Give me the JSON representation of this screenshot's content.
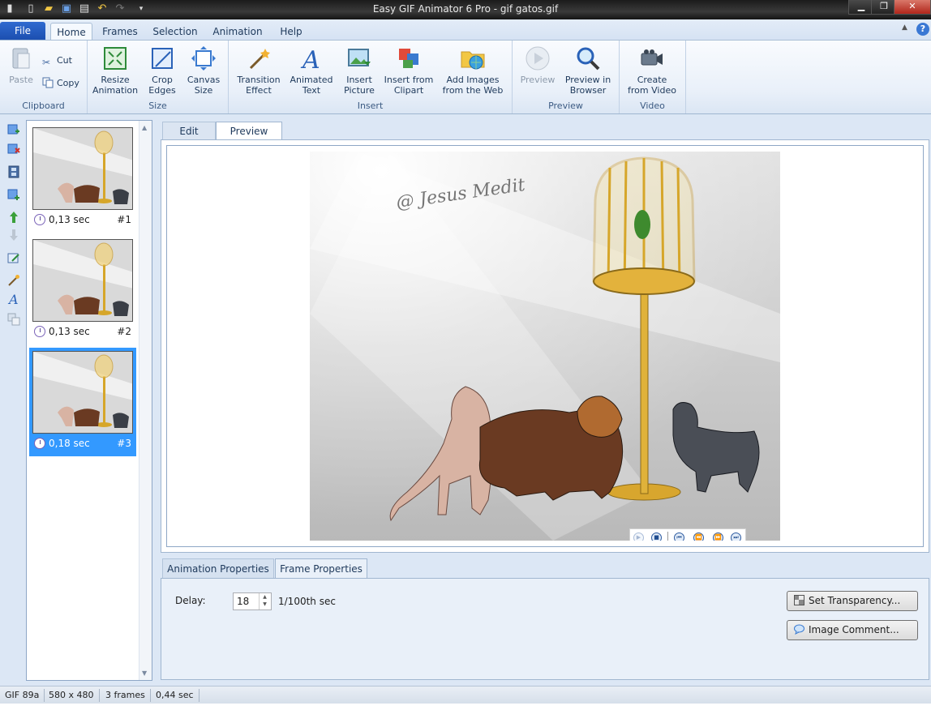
{
  "window": {
    "title": "Easy GIF Animator 6 Pro - gif gatos.gif"
  },
  "ribbon": {
    "file_tab": "File",
    "tabs": [
      {
        "label": "Home"
      },
      {
        "label": "Frames"
      },
      {
        "label": "Selection"
      },
      {
        "label": "Animation"
      },
      {
        "label": "Help"
      }
    ],
    "groups": {
      "clipboard": {
        "label": "Clipboard",
        "paste": "Paste",
        "cut": "Cut",
        "copy": "Copy"
      },
      "size": {
        "label": "Size",
        "resize": "Resize\nAnimation",
        "crop": "Crop\nEdges",
        "canvas": "Canvas\nSize"
      },
      "insert": {
        "label": "Insert",
        "transition": "Transition\nEffect",
        "text": "Animated\nText",
        "picture": "Insert\nPicture",
        "clipart": "Insert from\nClipart",
        "web": "Add Images\nfrom the Web"
      },
      "preview": {
        "label": "Preview",
        "preview": "Preview",
        "browser": "Preview in\nBrowser"
      },
      "video": {
        "label": "Video",
        "create": "Create\nfrom Video"
      }
    },
    "help_icon": "?"
  },
  "frames": [
    {
      "delay": "0,13 sec",
      "number": "#1",
      "selected": false
    },
    {
      "delay": "0,13 sec",
      "number": "#2",
      "selected": false
    },
    {
      "delay": "0,18 sec",
      "number": "#3",
      "selected": true
    }
  ],
  "editor": {
    "tabs": [
      {
        "label": "Edit"
      },
      {
        "label": "Preview"
      }
    ],
    "watermark": "@ Jesus Medit"
  },
  "properties": {
    "tabs": [
      {
        "label": "Animation Properties"
      },
      {
        "label": "Frame Properties"
      }
    ],
    "delay_label": "Delay:",
    "delay_value": "18",
    "delay_unit": "1/100th sec",
    "set_transparency": "Set Transparency...",
    "image_comment": "Image Comment..."
  },
  "status": {
    "format": "GIF 89a",
    "dimensions": "580 x 480",
    "frames": "3 frames",
    "duration": "0,44 sec"
  },
  "colors": {
    "accent": "#3399ff",
    "ribbon_file": "#2f6ad0"
  }
}
